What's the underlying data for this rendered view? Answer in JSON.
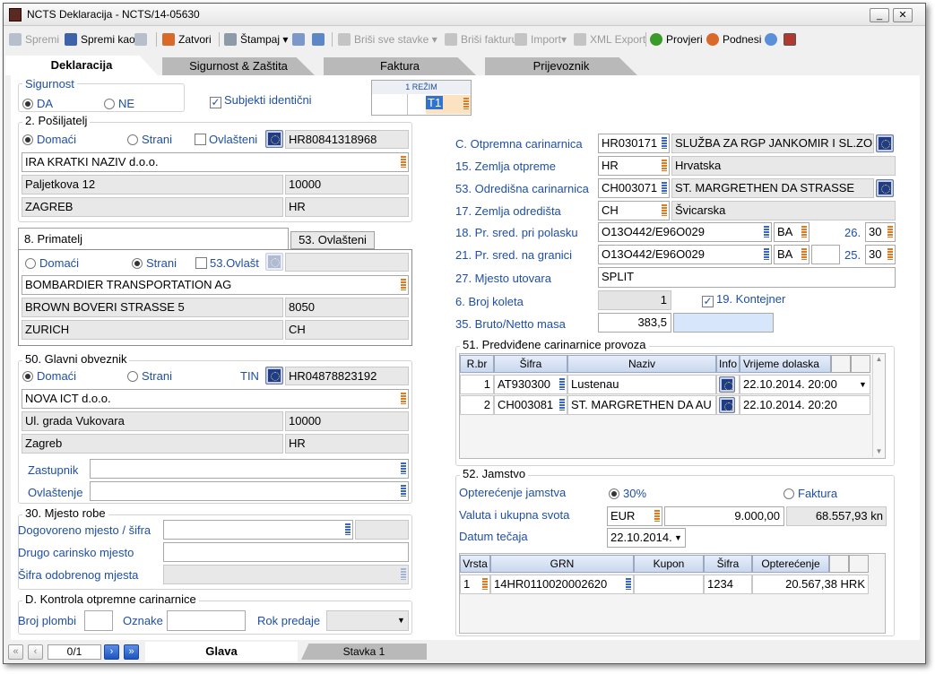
{
  "window": {
    "title": "NCTS Deklaracija - NCTS/14-05630",
    "minimize": "_",
    "close": "✕"
  },
  "toolbar": {
    "spremi": "Spremi",
    "spremi_kao": "Spremi kao",
    "zatvori": "Zatvori",
    "stampaj": "Štampaj",
    "brisi_stavke": "Briši sve stavke",
    "brisi_fakturu": "Briši fakturu",
    "import": "Import",
    "xml_export": "XML Export",
    "provjeri": "Provjeri",
    "podnesi": "Podnesi"
  },
  "tabs": [
    "Deklaracija",
    "Sigurnost & Zaštita",
    "Faktura",
    "Prijevoznik"
  ],
  "sigurnost": {
    "title": "Sigurnost",
    "da": "DA",
    "ne": "NE",
    "subjekti": "Subjekti identični"
  },
  "rezim": {
    "label": "1 REŽIM",
    "value": "T1"
  },
  "posiljatelj": {
    "title": "2. Pošiljatelj",
    "domaci": "Domaći",
    "strani": "Strani",
    "ovlasteni": "Ovlašteni",
    "id": "HR80841318968",
    "naziv": "IRA KRATKI NAZIV d.o.o.",
    "adresa": "Paljetkova 12",
    "postanski": "10000",
    "grad": "ZAGREB",
    "drzava": "HR"
  },
  "primatelj": {
    "title": "8. Primatelj",
    "tab2": "53. Ovlašteni",
    "domaci": "Domaći",
    "strani": "Strani",
    "ovlast": "53.Ovlašt",
    "naziv": "BOMBARDIER TRANSPORTATION AG",
    "adresa": "BROWN BOVERI STRASSE 5",
    "postanski": "8050",
    "grad": "ZURICH",
    "drzava": "CH"
  },
  "obveznik": {
    "title": "50. Glavni obveznik",
    "domaci": "Domaći",
    "strani": "Strani",
    "tin": "TIN",
    "id": "HR04878823192",
    "naziv": "NOVA ICT d.o.o.",
    "adresa": "Ul. grada Vukovara",
    "postanski": "10000",
    "grad": "Zagreb",
    "drzava": "HR",
    "zastupnik": "Zastupnik",
    "ovlastenje": "Ovlaštenje"
  },
  "mjesto_robe": {
    "title": "30. Mjesto robe",
    "dogovoreno": "Dogovoreno mjesto / šifra",
    "drugo": "Drugo carinsko mjesto",
    "sifra_odobrenog": "Šifra odobrenog mjesta"
  },
  "kontrola": {
    "title": "D. Kontrola otpremne carinarnice",
    "broj_plombi": "Broj plombi",
    "oznake": "Oznake",
    "rok": "Rok predaje"
  },
  "right": {
    "otpremna_lbl": "C. Otpremna carinarnica",
    "otpremna_code": "HR030171",
    "otpremna_name": "SLUŽBA ZA RGP JANKOMIR I SL.ZONA",
    "zemlja_otp_lbl": "15. Zemlja otpreme",
    "zemlja_otp_code": "HR",
    "zemlja_otp_name": "Hrvatska",
    "odredisna_lbl": "53. Odredišna carinarnica",
    "odredisna_code": "CH003071",
    "odredisna_name": "ST. MARGRETHEN DA STRASSE",
    "zemlja_odr_lbl": "17. Zemlja odredišta",
    "zemlja_odr_code": "CH",
    "zemlja_odr_name": "Švicarska",
    "pr_polasku_lbl": "18. Pr. sred. pri polasku",
    "pr_polasku": "O13O442/E96O029",
    "pr_polasku_c": "BA",
    "n26_lbl": "26.",
    "n26": "30",
    "pr_granici_lbl": "21. Pr. sred. na granici",
    "pr_granici": "O13O442/E96O029",
    "pr_granici_c": "BA",
    "n25_lbl": "25.",
    "n25": "30",
    "mjesto_lbl": "27. Mjesto utovara",
    "mjesto": "SPLIT",
    "koleta_lbl": "6. Broj koleta",
    "koleta": "1",
    "kontejner": "19. Kontejner",
    "masa_lbl": "35. Bruto/Netto masa",
    "masa": "383,5"
  },
  "provoz": {
    "title": "51. Predviđene carinarnice provoza",
    "headers": [
      "R.br",
      "Šifra",
      "Naziv",
      "Info",
      "Vrijeme dolaska"
    ],
    "rows": [
      {
        "rb": "1",
        "sifra": "AT930300",
        "naziv": "Lustenau",
        "vrijeme": "22.10.2014. 20:00"
      },
      {
        "rb": "2",
        "sifra": "CH003081",
        "naziv": "ST. MARGRETHEN DA AU",
        "vrijeme": "22.10.2014. 20:20"
      }
    ]
  },
  "jamstvo": {
    "title": "52. Jamstvo",
    "opterecenje_lbl": "Opterećenje jamstva",
    "p30": "30%",
    "faktura": "Faktura",
    "valuta_lbl": "Valuta i ukupna svota",
    "valuta": "EUR",
    "iznos": "9.000,00",
    "kn": "68.557,93 kn",
    "datum_lbl": "Datum tečaja",
    "datum": "22.10.2014.",
    "headers": [
      "Vrsta",
      "GRN",
      "Kupon",
      "Šifra",
      "Opterećenje"
    ],
    "rows": [
      {
        "vrsta": "1",
        "grn": "14HR0110020002620",
        "kupon": "",
        "sifra": "1234",
        "opterecenje": "20.567,38 HRK"
      }
    ]
  },
  "bottom": {
    "page": "0/1",
    "glava": "Glava",
    "stavka": "Stavka 1"
  }
}
